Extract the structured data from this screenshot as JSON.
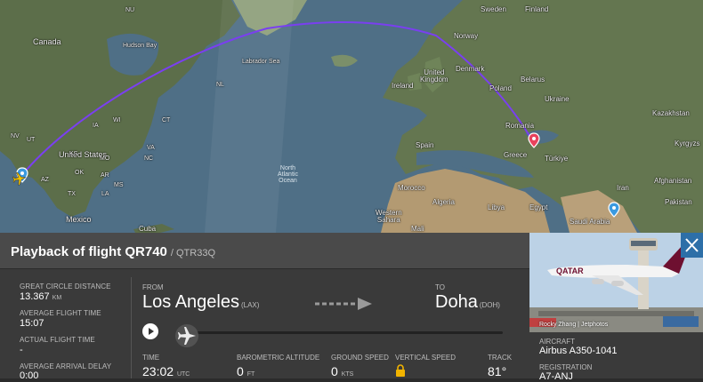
{
  "map": {
    "labels": {
      "canada": "Canada",
      "hudson_bay": "Hudson Bay",
      "labrador_sea": "Labrador Sea",
      "united_states": "United States",
      "mexico": "Mexico",
      "cuba": "Cuba",
      "north_atlantic_ocean": "North\nAtlantic\nOcean",
      "sweden": "Sweden",
      "finland": "Finland",
      "norway": "Norway",
      "denmark": "Denmark",
      "united_kingdom": "United\nKingdom",
      "ireland": "Ireland",
      "poland": "Poland",
      "belarus": "Belarus",
      "ukraine": "Ukraine",
      "romania": "Romania",
      "greece": "Greece",
      "turkiye": "Türkiye",
      "kazakhstan": "Kazakhstan",
      "kyrgyz": "Kyrgyzs",
      "spain": "Spain",
      "morocco": "Morocco",
      "algeria": "Algeria",
      "libya": "Libya",
      "egypt": "Egypt",
      "western_sahara": "Western\nSahara",
      "mali": "Mali",
      "saudi_arabia": "Saudi Arabia",
      "iran": "Iran",
      "afghanistan": "Afghanistan",
      "pakistan": "Pakistan",
      "nu": "NU",
      "nl": "NL",
      "nv": "NV",
      "ut": "UT",
      "az": "AZ",
      "ks": "KS",
      "ia": "IA",
      "ok": "OK",
      "mo": "MO",
      "ar": "AR",
      "tx": "TX",
      "la": "LA",
      "ms": "MS",
      "nc": "NC",
      "va": "VA",
      "wi": "WI",
      "ct": "CT"
    }
  },
  "flight": {
    "title": "Playback of flight QR740",
    "callsign": "/ QTR33Q",
    "stats": [
      {
        "label": "Great Circle Distance",
        "value": "13.367",
        "unit": "KM"
      },
      {
        "label": "Average Flight Time",
        "value": "15:07",
        "unit": ""
      },
      {
        "label": "Actual Flight Time",
        "value": "-",
        "unit": ""
      },
      {
        "label": "Average Arrival Delay",
        "value": "0:00",
        "unit": ""
      }
    ],
    "from_label": "FROM",
    "from_city": "Los Angeles",
    "from_code": "(LAX)",
    "to_label": "TO",
    "to_city": "Doha",
    "to_code": "(DOH)",
    "metrics": [
      {
        "label": "Time",
        "value": "23:02",
        "unit": "UTC"
      },
      {
        "label": "Barometric Altitude",
        "value": "0",
        "unit": "FT"
      },
      {
        "label": "Ground Speed",
        "value": "0",
        "unit": "KTS"
      },
      {
        "label": "Vertical Speed",
        "value": "",
        "unit": ""
      },
      {
        "label": "Track",
        "value": "81°",
        "unit": ""
      }
    ],
    "playback_progress": 0
  },
  "aircraft": {
    "photo_credit": "Rocky Zhang | Jetphotos",
    "livery_text": "QATAR",
    "aircraft_label": "AIRCRAFT",
    "aircraft_value": "Airbus A350-1041",
    "registration_label": "REGISTRATION",
    "registration_value": "A7-ANJ"
  },
  "colors": {
    "route": "#7a3ff0",
    "accent_close": "#2d6fa8",
    "lock": "#f2b400"
  }
}
